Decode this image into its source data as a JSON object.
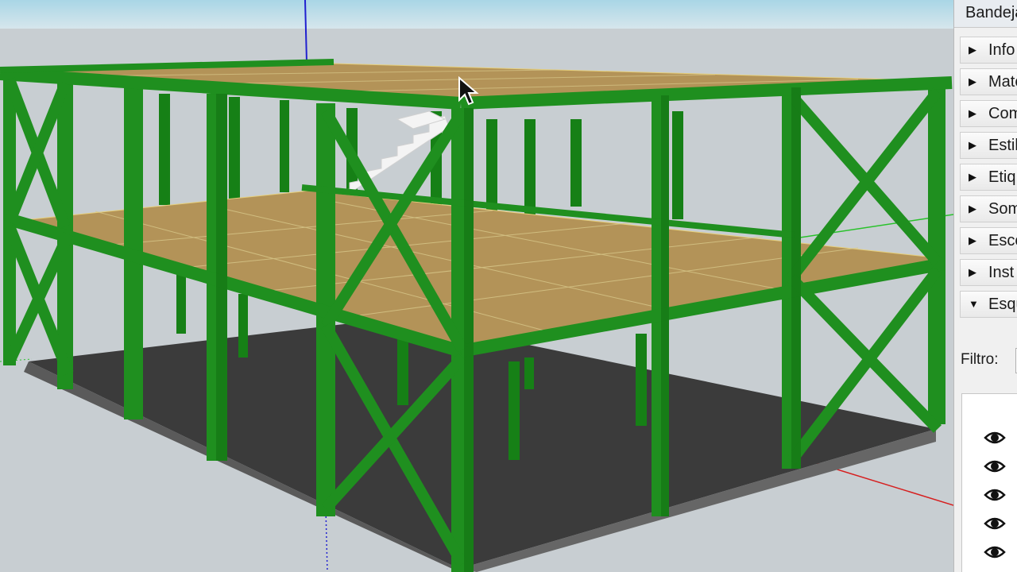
{
  "tray": {
    "title": "Bandeja",
    "panels": [
      {
        "label": "Info",
        "state": "collapsed"
      },
      {
        "label": "Mate",
        "state": "collapsed"
      },
      {
        "label": "Com",
        "state": "collapsed"
      },
      {
        "label": "Estil",
        "state": "collapsed"
      },
      {
        "label": "Etiq",
        "state": "collapsed"
      },
      {
        "label": "Som",
        "state": "collapsed"
      },
      {
        "label": "Esce",
        "state": "collapsed"
      },
      {
        "label": "Inst",
        "state": "collapsed"
      },
      {
        "label": "Esqu",
        "state": "expanded"
      }
    ],
    "filter_label": "Filtro:",
    "filter_value": "",
    "outliner_rows": [
      "eye-icon",
      "eye-icon",
      "eye-icon",
      "eye-icon",
      "eye-icon"
    ]
  },
  "colors": {
    "sky": "#b8dce8",
    "ground": "#c7cdd1",
    "steel": "#1f8f1f",
    "steel_dark": "#117011",
    "slab": "#b39358",
    "floor": "#3c3c3c",
    "axis_red": "#d61f1f",
    "axis_green": "#29c22b",
    "axis_blue": "#2020d0"
  }
}
